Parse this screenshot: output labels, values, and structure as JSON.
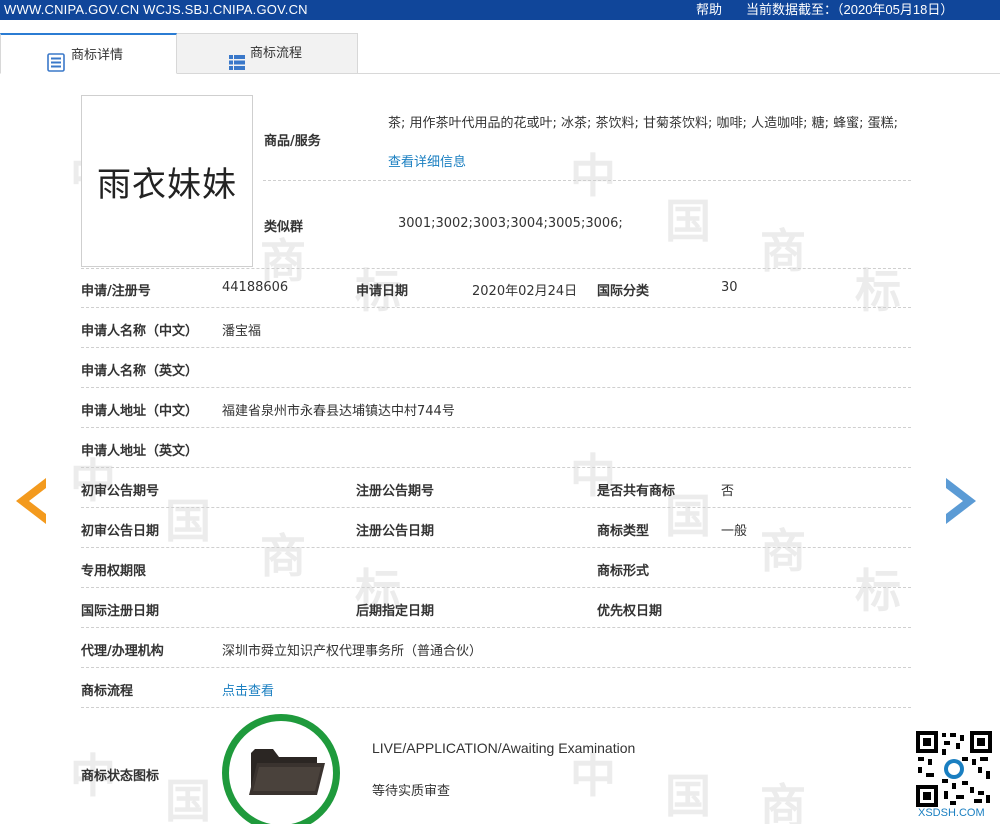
{
  "topbar": {
    "url": "WWW.CNIPA.GOV.CN WCJS.SBJ.CNIPA.GOV.CN",
    "help": "帮助",
    "date_notice": "当前数据截至：（2020年05月18日）",
    "bg_color": "#10469a"
  },
  "tabs": [
    {
      "label": "商标详情",
      "icon": "document-icon",
      "active": true
    },
    {
      "label": "商标流程",
      "icon": "list-icon",
      "active": false
    }
  ],
  "watermark": {
    "chars": [
      "中",
      "国",
      "商",
      "标"
    ]
  },
  "trademark": {
    "mark_text": "雨衣妹妹",
    "goods_label": "商品/服务",
    "goods_text": "茶; 用作茶叶代用品的花或叶; 冰茶; 茶饮料; 甘菊茶饮料; 咖啡; 人造咖啡; 糖; 蜂蜜; 蛋糕; ",
    "goods_link": "查看详细信息",
    "similar_label": "类似群",
    "similar_value": "3001;3002;3003;3004;3005;3006;"
  },
  "fields": {
    "reg_no_label": "申请/注册号",
    "reg_no_value": "44188606",
    "apply_date_label": "申请日期",
    "apply_date_value": "2020年02月24日",
    "intl_class_label": "国际分类",
    "intl_class_value": "30",
    "applicant_cn_label": "申请人名称（中文）",
    "applicant_cn_value": "潘宝福",
    "applicant_en_label": "申请人名称（英文）",
    "address_cn_label": "申请人地址（中文）",
    "address_cn_value": "福建省泉州市永春县达埔镇达中村744号",
    "address_en_label": "申请人地址（英文）",
    "prelim_pub_no_label": "初审公告期号",
    "reg_pub_no_label": "注册公告期号",
    "shared_label": "是否共有商标",
    "shared_value": "否",
    "prelim_pub_date_label": "初审公告日期",
    "reg_pub_date_label": "注册公告日期",
    "type_label": "商标类型",
    "type_value": "一般",
    "exclusive_period_label": "专用权期限",
    "form_label": "商标形式",
    "intl_reg_date_label": "国际注册日期",
    "later_date_label": "后期指定日期",
    "priority_date_label": "优先权日期",
    "agent_label": "代理/办理机构",
    "agent_value": "深圳市舜立知识产权代理事务所（普通合伙）",
    "process_label": "商标流程",
    "process_link": "点击查看",
    "status_icon_label": "商标状态图标",
    "status_en": "LIVE/APPLICATION/Awaiting Examination",
    "status_cn": "等待实质审查"
  },
  "qr": {
    "label": "XSDSH.COM"
  },
  "colors": {
    "accent": "#1a7fc1",
    "arrow_left": "#f39a1e",
    "arrow_right": "#5b9bd5",
    "status_ring": "#1f9a3c"
  }
}
